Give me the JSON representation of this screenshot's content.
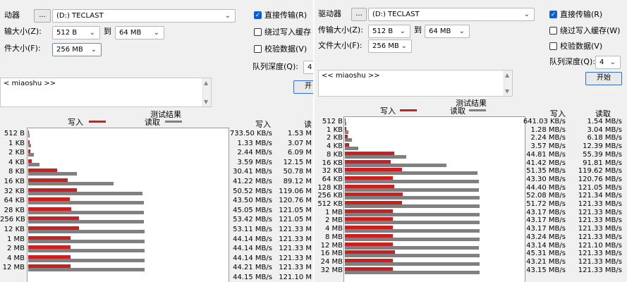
{
  "colors": {
    "write": "#cc1f1f",
    "read": "#808080",
    "accent": "#0a5fd8"
  },
  "left": {
    "drive_label": "动器",
    "browse_label": "...",
    "drive_value": "(D:) TECLAST",
    "direct_io_label": "直接传输(R)",
    "transfer_size_label": "输大小(Z):",
    "transfer_from": "512 B",
    "to_label": "到",
    "transfer_to": "64 MB",
    "bypass_label": "绕过写入缓存",
    "file_size_label": "件大小(F):",
    "file_size": "256 MB",
    "verify_label": "校验数据(V)",
    "queue_label": "队列深度(Q):",
    "queue_value": "4",
    "start_label": "开",
    "desc_text": "< miaoshu >>",
    "chart_title": "测试结果",
    "legend_write": "写入",
    "legend_read": "读取",
    "col_write": "写入",
    "col_read": "读",
    "sizes": [
      "512 B",
      "1 KB",
      "2 KB",
      "4 KB",
      "8 KB",
      "16 KB",
      "32 KB",
      "64 KB",
      "28 KB",
      "256 KB",
      "12 KB",
      "1 MB",
      "2 MB",
      "4 MB",
      "12 MB"
    ],
    "write": [
      "733.50 KB/s",
      "1.33 MB/s",
      "2.44 MB/s",
      "3.59 MB/s",
      "30.41 MB/s",
      "41.22 MB/s",
      "50.52 MB/s",
      "43.50 MB/s",
      "45.05 MB/s",
      "53.42 MB/s",
      "53.11 MB/s",
      "44.14 MB/s",
      "44.14 MB/s",
      "44.14 MB/s",
      "44.21 MB/s",
      "44.15 MB/s"
    ],
    "read": [
      "1.53 M",
      "3.07 M",
      "6.09 M",
      "12.15 M",
      "50.78 M",
      "89.12 M",
      "119.06 M",
      "120.76 M",
      "121.05 M",
      "121.05 M",
      "121.33 M",
      "121.33 M",
      "121.33 M",
      "121.33 M",
      "121.33 M",
      "121.10 M"
    ]
  },
  "right": {
    "drive_label": "驱动器",
    "browse_label": "...",
    "drive_value": "(D:) TECLAST",
    "direct_io_label": "直接传输(R)",
    "transfer_size_label": "传输大小(Z):",
    "transfer_from": "512 B",
    "to_label": "到",
    "transfer_to": "64 MB",
    "bypass_label": "绕过写入缓存(W)",
    "file_size_label": "文件大小(F):",
    "file_size": "256 MB",
    "verify_label": "校验数据(V)",
    "queue_label": "队列深度(Q):",
    "queue_value": "4",
    "start_label": "开始",
    "desc_text": "<< miaoshu >>",
    "chart_title": "测试结果",
    "legend_write": "写入",
    "legend_read": "读取",
    "col_write": "写入",
    "col_read": "读取",
    "sizes": [
      "512 B",
      "1 KB",
      "2 KB",
      "4 KB",
      "8 KB",
      "16 KB",
      "32 KB",
      "64 KB",
      "128 KB",
      "256 KB",
      "512 KB",
      "1 MB",
      "2 MB",
      "4 MB",
      "8 MB",
      "12 MB",
      "16 MB",
      "24 MB",
      "32 MB"
    ],
    "write": [
      "641.03 KB/s",
      "1.28 MB/s",
      "2.24 MB/s",
      "3.57 MB/s",
      "44.81 MB/s",
      "41.42 MB/s",
      "51.35 MB/s",
      "43.30 MB/s",
      "44.40 MB/s",
      "52.08 MB/s",
      "51.72 MB/s",
      "43.17 MB/s",
      "43.17 MB/s",
      "43.17 MB/s",
      "43.24 MB/s",
      "43.14 MB/s",
      "45.31 MB/s",
      "43.21 MB/s",
      "43.15 MB/s"
    ],
    "read": [
      "1.54 MB/s",
      "3.04 MB/s",
      "6.18 MB/s",
      "12.39 MB/s",
      "55.39 MB/s",
      "91.81 MB/s",
      "119.62 MB/s",
      "120.76 MB/s",
      "121.05 MB/s",
      "121.34 MB/s",
      "121.33 MB/s",
      "121.33 MB/s",
      "121.33 MB/s",
      "121.33 MB/s",
      "121.33 MB/s",
      "121.10 MB/s",
      "121.33 MB/s",
      "121.33 MB/s",
      "121.33 MB/s"
    ]
  },
  "chart_data": [
    {
      "type": "bar",
      "title": "测试结果",
      "categories": [
        "512 B",
        "1 KB",
        "2 KB",
        "4 KB",
        "8 KB",
        "16 KB",
        "32 KB",
        "64 KB",
        "28 KB",
        "256 KB",
        "12 KB",
        "1 MB",
        "2 MB",
        "4 MB",
        "12 MB"
      ],
      "series": [
        {
          "name": "写入",
          "values": [
            0.72,
            1.33,
            2.44,
            3.59,
            30.41,
            41.22,
            50.52,
            43.5,
            45.05,
            53.42,
            53.11,
            44.14,
            44.14,
            44.14,
            44.21
          ]
        },
        {
          "name": "读取",
          "values": [
            1.53,
            3.07,
            6.09,
            12.15,
            50.78,
            89.12,
            119.06,
            120.76,
            121.05,
            121.05,
            121.33,
            121.33,
            121.33,
            121.33,
            121.33
          ]
        }
      ],
      "xlim": [
        0,
        140
      ],
      "legend": "top"
    },
    {
      "type": "bar",
      "title": "测试结果",
      "categories": [
        "512 B",
        "1 KB",
        "2 KB",
        "4 KB",
        "8 KB",
        "16 KB",
        "32 KB",
        "64 KB",
        "128 KB",
        "256 KB",
        "512 KB",
        "1 MB",
        "2 MB",
        "4 MB",
        "8 MB",
        "12 MB",
        "16 MB",
        "24 MB",
        "32 MB"
      ],
      "series": [
        {
          "name": "写入",
          "values": [
            0.63,
            1.28,
            2.24,
            3.57,
            44.81,
            41.42,
            51.35,
            43.3,
            44.4,
            52.08,
            51.72,
            43.17,
            43.17,
            43.17,
            43.24,
            43.14,
            45.31,
            43.21,
            43.15
          ]
        },
        {
          "name": "读取",
          "values": [
            1.54,
            3.04,
            6.18,
            12.39,
            55.39,
            91.81,
            119.62,
            120.76,
            121.05,
            121.34,
            121.33,
            121.33,
            121.33,
            121.33,
            121.33,
            121.1,
            121.33,
            121.33,
            121.33
          ]
        }
      ],
      "xlim": [
        0,
        140
      ],
      "legend": "top"
    }
  ]
}
